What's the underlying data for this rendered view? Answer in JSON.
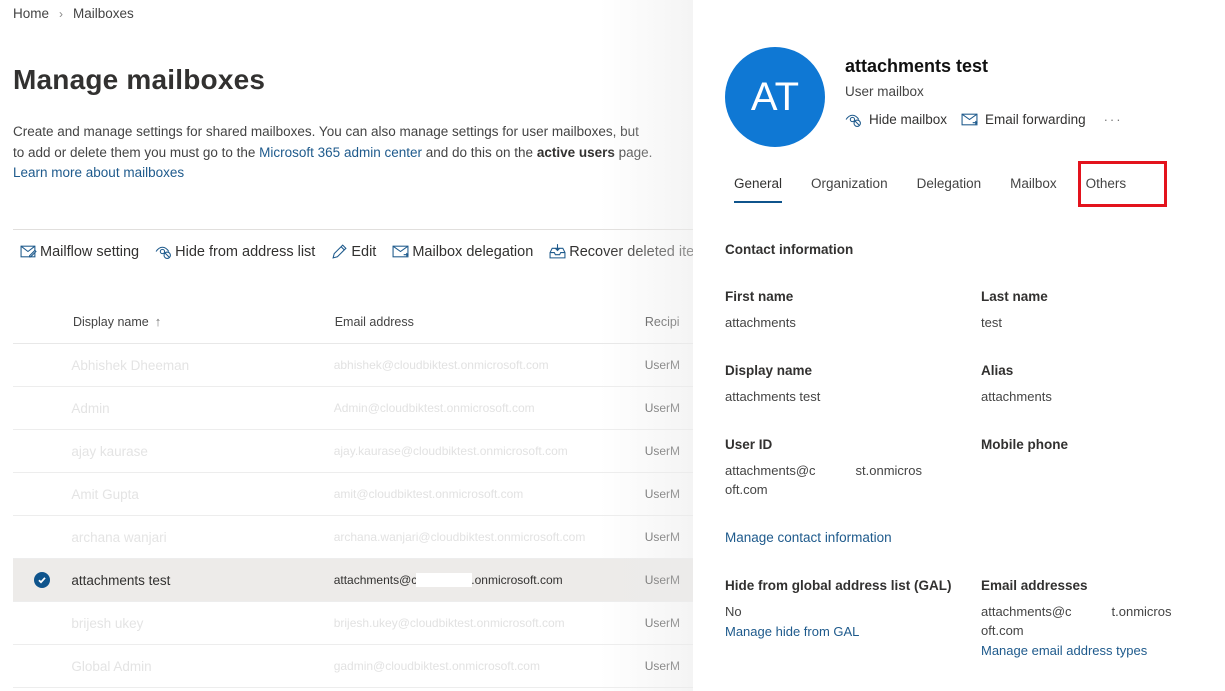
{
  "breadcrumb": {
    "home": "Home",
    "separator": "›",
    "current": "Mailboxes"
  },
  "page": {
    "title": "Manage mailboxes",
    "description": {
      "part1": "Create and manage settings for shared mailboxes. You can also manage settings for user mailboxes, but to add or delete them you must go to the ",
      "link1": "Microsoft 365 admin center",
      "part2": " and do this on the ",
      "bold": "active users",
      "part3": " page. ",
      "link2": "Learn more about mailboxes"
    }
  },
  "toolbar": [
    {
      "icon": "mailflow-setting-icon",
      "label": "Mailflow setting"
    },
    {
      "icon": "hide-icon",
      "label": "Hide from address list"
    },
    {
      "icon": "edit-icon",
      "label": "Edit"
    },
    {
      "icon": "mailbox-delegation-icon",
      "label": "Mailbox delegation"
    },
    {
      "icon": "recover-icon",
      "label": "Recover deleted ite"
    }
  ],
  "table": {
    "columns": {
      "display_name": "Display name",
      "sort": "↑",
      "email": "Email address",
      "recipient": "Recipi"
    },
    "rows": [
      {
        "name": "Abhishek Dheeman",
        "email": "abhishek@cloudbiktest.onmicrosoft.com",
        "recipient": "UserM",
        "selected": false
      },
      {
        "name": "Admin",
        "email": "Admin@cloudbiktest.onmicrosoft.com",
        "recipient": "UserM",
        "selected": false
      },
      {
        "name": "ajay kaurase",
        "email": "ajay.kaurase@cloudbiktest.onmicrosoft.com",
        "recipient": "UserM",
        "selected": false
      },
      {
        "name": "Amit Gupta",
        "email": "amit@cloudbiktest.onmicrosoft.com",
        "recipient": "UserM",
        "selected": false
      },
      {
        "name": "archana wanjari",
        "email": "archana.wanjari@cloudbiktest.onmicrosoft.com",
        "recipient": "UserM",
        "selected": false
      },
      {
        "name": "attachments test",
        "email_prefix": "attachments@c",
        "email_suffix": ".onmicrosoft.com",
        "recipient": "UserM",
        "selected": true
      },
      {
        "name": "brijesh ukey",
        "email": "brijesh.ukey@cloudbiktest.onmicrosoft.com",
        "recipient": "UserM",
        "selected": false
      },
      {
        "name": "Global Admin",
        "email": "gadmin@cloudbiktest.onmicrosoft.com",
        "recipient": "UserM",
        "selected": false
      }
    ]
  },
  "panel": {
    "avatar_initials": "AT",
    "avatar_color": "#0f78d4",
    "title": "attachments test",
    "subtitle": "User mailbox",
    "actions": {
      "hide": "Hide mailbox",
      "forward": "Email forwarding",
      "more": "···"
    },
    "tabs": [
      "General",
      "Organization",
      "Delegation",
      "Mailbox",
      "Others"
    ],
    "active_tab": "General",
    "highlighted_tab": "Others",
    "highlight_color": "#e3131d",
    "section_title": "Contact information",
    "fields": {
      "first_name": {
        "label": "First name",
        "value": "attachments"
      },
      "last_name": {
        "label": "Last name",
        "value": "test"
      },
      "display_name": {
        "label": "Display name",
        "value": "attachments test"
      },
      "alias": {
        "label": "Alias",
        "value": "attachments"
      },
      "user_id": {
        "label": "User ID",
        "value_prefix": "attachments@c",
        "value_suffix": "st.onmicros",
        "value_line2": "oft.com"
      },
      "mobile_phone": {
        "label": "Mobile phone",
        "value": ""
      },
      "gal": {
        "label": "Hide from global address list (GAL)",
        "value": "No",
        "link": "Manage hide from GAL"
      },
      "email_addresses": {
        "label": "Email addresses",
        "value_prefix": "attachments@c",
        "value_suffix": "t.onmicros",
        "value_line2": "oft.com",
        "link": "Manage email address types"
      }
    },
    "manage_contact_link": "Manage contact information"
  }
}
